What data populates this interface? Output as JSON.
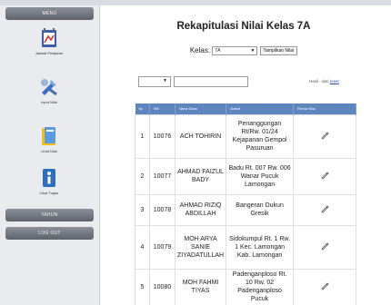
{
  "sidebar": {
    "header_top": "MENU",
    "items": [
      {
        "label": "Jadwal Pelajaran",
        "icon": "calendar-icon"
      },
      {
        "label": "Input Nilai",
        "icon": "tools-icon"
      },
      {
        "label": "Lihat Nilai",
        "icon": "book-icon"
      },
      {
        "label": "Lihat Tugas",
        "icon": "info-icon"
      }
    ],
    "header_mid": "TAHUN",
    "header_bottom": "LOG OUT"
  },
  "main": {
    "title": "Rekapitulasi Nilai Kelas 7A",
    "kelas_label": "Kelas:",
    "kelas_value": "7A",
    "tampilkan_label": "Tampilkan Nilai",
    "hasil_text": "Hasil - dari",
    "reset_label": "reset"
  },
  "table": {
    "headers": [
      "No",
      "NIS",
      "Nama Siswa",
      "Alamat",
      "Rincian Nilai"
    ],
    "rows": [
      {
        "no": "1",
        "nis": "10076",
        "nama": "ACH TOHIRIN",
        "alamat": "Penanggungan Rt/Rw. 01/24 Kejapanan Gempol Pasuruan"
      },
      {
        "no": "2",
        "nis": "10077",
        "nama": "AHMAD FAIZUL BADY",
        "alamat": "Badu Rt. 007 Rw. 006 Wanar Pucuk Lamongan"
      },
      {
        "no": "3",
        "nis": "10078",
        "nama": "AHMAD RIZIQ ABDILLAH",
        "alamat": "Bangeran Dukun Gresik"
      },
      {
        "no": "4",
        "nis": "10079",
        "nama": "MOH ARYA SANIE ZIYADATULLAH",
        "alamat": "Sidokumpul Rt. 1 Rw. 1 Kec. Lamongan Kab. Lamongan"
      },
      {
        "no": "5",
        "nis": "10080",
        "nama": "MOH FAHMI TIYAS",
        "alamat": "Padenganploso Rt. 10 Rw. 02 Padenganploso Pucuk"
      }
    ]
  },
  "colors": {
    "header_blue": "#5d86be",
    "sidebar_bg": "#e9ebee",
    "menu_bar": "#6f737a"
  }
}
